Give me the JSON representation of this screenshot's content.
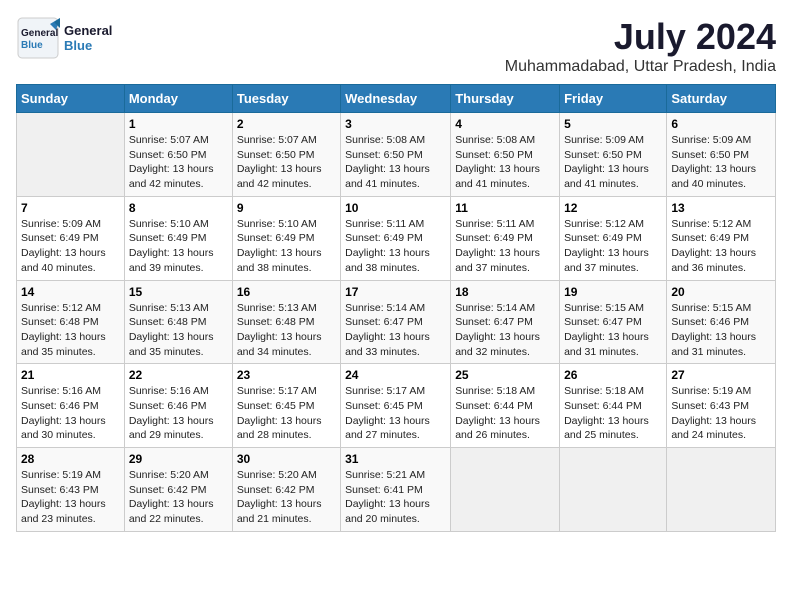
{
  "header": {
    "logo_general": "General",
    "logo_blue": "Blue",
    "title": "July 2024",
    "location": "Muhammadabad, Uttar Pradesh, India"
  },
  "calendar": {
    "days_of_week": [
      "Sunday",
      "Monday",
      "Tuesday",
      "Wednesday",
      "Thursday",
      "Friday",
      "Saturday"
    ],
    "weeks": [
      [
        {
          "day": "",
          "info": ""
        },
        {
          "day": "1",
          "info": "Sunrise: 5:07 AM\nSunset: 6:50 PM\nDaylight: 13 hours\nand 42 minutes."
        },
        {
          "day": "2",
          "info": "Sunrise: 5:07 AM\nSunset: 6:50 PM\nDaylight: 13 hours\nand 42 minutes."
        },
        {
          "day": "3",
          "info": "Sunrise: 5:08 AM\nSunset: 6:50 PM\nDaylight: 13 hours\nand 41 minutes."
        },
        {
          "day": "4",
          "info": "Sunrise: 5:08 AM\nSunset: 6:50 PM\nDaylight: 13 hours\nand 41 minutes."
        },
        {
          "day": "5",
          "info": "Sunrise: 5:09 AM\nSunset: 6:50 PM\nDaylight: 13 hours\nand 41 minutes."
        },
        {
          "day": "6",
          "info": "Sunrise: 5:09 AM\nSunset: 6:50 PM\nDaylight: 13 hours\nand 40 minutes."
        }
      ],
      [
        {
          "day": "7",
          "info": "Sunrise: 5:09 AM\nSunset: 6:49 PM\nDaylight: 13 hours\nand 40 minutes."
        },
        {
          "day": "8",
          "info": "Sunrise: 5:10 AM\nSunset: 6:49 PM\nDaylight: 13 hours\nand 39 minutes."
        },
        {
          "day": "9",
          "info": "Sunrise: 5:10 AM\nSunset: 6:49 PM\nDaylight: 13 hours\nand 38 minutes."
        },
        {
          "day": "10",
          "info": "Sunrise: 5:11 AM\nSunset: 6:49 PM\nDaylight: 13 hours\nand 38 minutes."
        },
        {
          "day": "11",
          "info": "Sunrise: 5:11 AM\nSunset: 6:49 PM\nDaylight: 13 hours\nand 37 minutes."
        },
        {
          "day": "12",
          "info": "Sunrise: 5:12 AM\nSunset: 6:49 PM\nDaylight: 13 hours\nand 37 minutes."
        },
        {
          "day": "13",
          "info": "Sunrise: 5:12 AM\nSunset: 6:49 PM\nDaylight: 13 hours\nand 36 minutes."
        }
      ],
      [
        {
          "day": "14",
          "info": "Sunrise: 5:12 AM\nSunset: 6:48 PM\nDaylight: 13 hours\nand 35 minutes."
        },
        {
          "day": "15",
          "info": "Sunrise: 5:13 AM\nSunset: 6:48 PM\nDaylight: 13 hours\nand 35 minutes."
        },
        {
          "day": "16",
          "info": "Sunrise: 5:13 AM\nSunset: 6:48 PM\nDaylight: 13 hours\nand 34 minutes."
        },
        {
          "day": "17",
          "info": "Sunrise: 5:14 AM\nSunset: 6:47 PM\nDaylight: 13 hours\nand 33 minutes."
        },
        {
          "day": "18",
          "info": "Sunrise: 5:14 AM\nSunset: 6:47 PM\nDaylight: 13 hours\nand 32 minutes."
        },
        {
          "day": "19",
          "info": "Sunrise: 5:15 AM\nSunset: 6:47 PM\nDaylight: 13 hours\nand 31 minutes."
        },
        {
          "day": "20",
          "info": "Sunrise: 5:15 AM\nSunset: 6:46 PM\nDaylight: 13 hours\nand 31 minutes."
        }
      ],
      [
        {
          "day": "21",
          "info": "Sunrise: 5:16 AM\nSunset: 6:46 PM\nDaylight: 13 hours\nand 30 minutes."
        },
        {
          "day": "22",
          "info": "Sunrise: 5:16 AM\nSunset: 6:46 PM\nDaylight: 13 hours\nand 29 minutes."
        },
        {
          "day": "23",
          "info": "Sunrise: 5:17 AM\nSunset: 6:45 PM\nDaylight: 13 hours\nand 28 minutes."
        },
        {
          "day": "24",
          "info": "Sunrise: 5:17 AM\nSunset: 6:45 PM\nDaylight: 13 hours\nand 27 minutes."
        },
        {
          "day": "25",
          "info": "Sunrise: 5:18 AM\nSunset: 6:44 PM\nDaylight: 13 hours\nand 26 minutes."
        },
        {
          "day": "26",
          "info": "Sunrise: 5:18 AM\nSunset: 6:44 PM\nDaylight: 13 hours\nand 25 minutes."
        },
        {
          "day": "27",
          "info": "Sunrise: 5:19 AM\nSunset: 6:43 PM\nDaylight: 13 hours\nand 24 minutes."
        }
      ],
      [
        {
          "day": "28",
          "info": "Sunrise: 5:19 AM\nSunset: 6:43 PM\nDaylight: 13 hours\nand 23 minutes."
        },
        {
          "day": "29",
          "info": "Sunrise: 5:20 AM\nSunset: 6:42 PM\nDaylight: 13 hours\nand 22 minutes."
        },
        {
          "day": "30",
          "info": "Sunrise: 5:20 AM\nSunset: 6:42 PM\nDaylight: 13 hours\nand 21 minutes."
        },
        {
          "day": "31",
          "info": "Sunrise: 5:21 AM\nSunset: 6:41 PM\nDaylight: 13 hours\nand 20 minutes."
        },
        {
          "day": "",
          "info": ""
        },
        {
          "day": "",
          "info": ""
        },
        {
          "day": "",
          "info": ""
        }
      ]
    ]
  }
}
